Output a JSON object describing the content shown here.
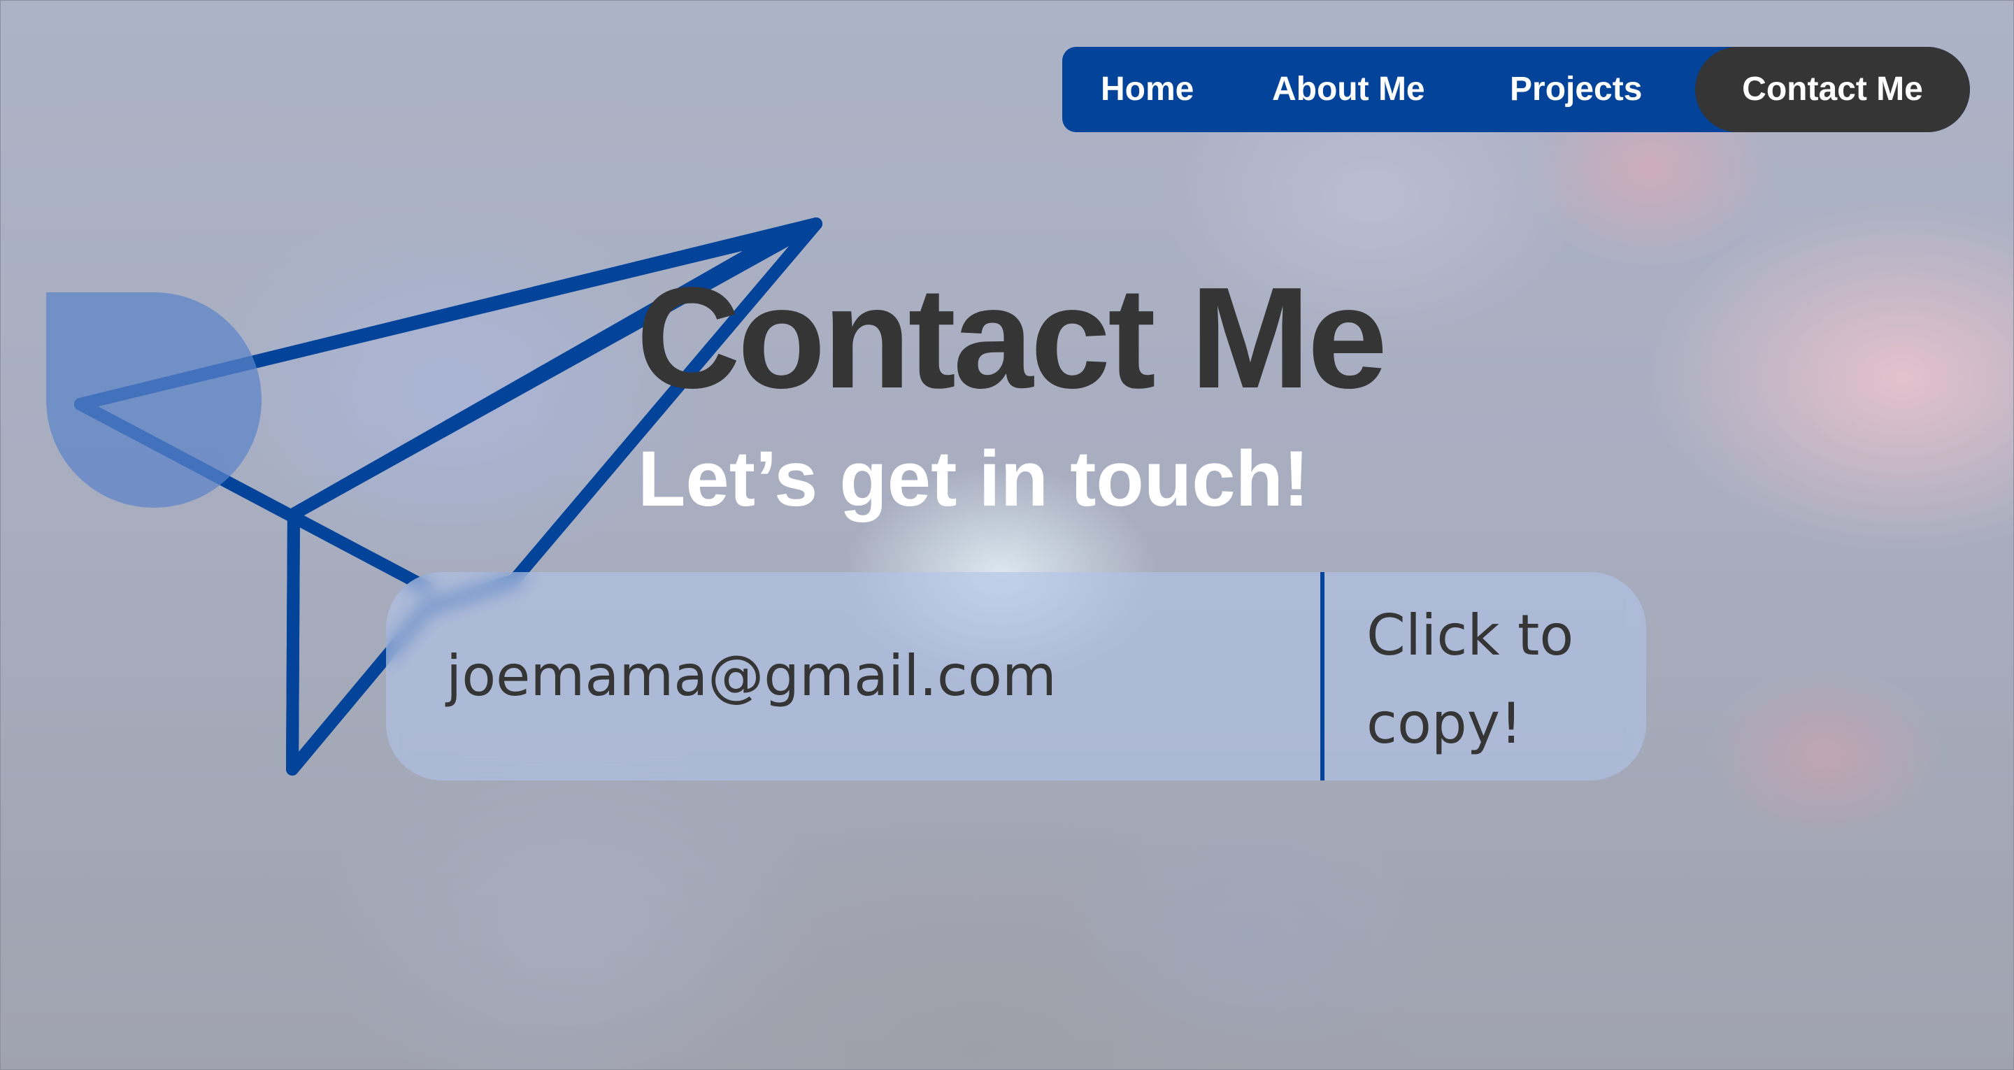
{
  "nav": {
    "items": [
      {
        "label": "Home",
        "active": false
      },
      {
        "label": "About Me",
        "active": false
      },
      {
        "label": "Projects",
        "active": false
      },
      {
        "label": "Contact Me",
        "active": true
      }
    ]
  },
  "hero": {
    "title": "Contact Me",
    "subtitle": "Let’s get in touch!"
  },
  "email_card": {
    "email": "joemama@gmail.com",
    "copy_label": "Click to copy!"
  },
  "graphics": {
    "icon": "paper-plane-icon"
  },
  "colors": {
    "accent": "#03449a",
    "dark": "#353535",
    "text_light": "#ffffff",
    "card": "#b2c4e8"
  }
}
